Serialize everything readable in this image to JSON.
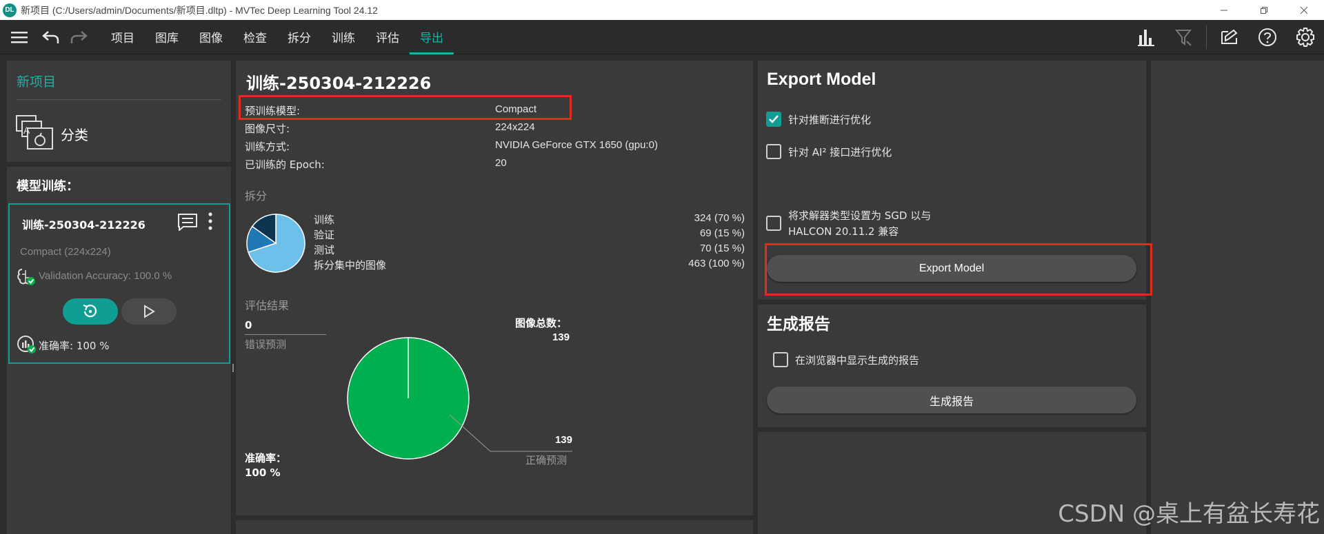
{
  "window": {
    "logo": "DL",
    "title": "新项目 (C:/Users/admin/Documents/新项目.dltp) - MVTec Deep Learning Tool 24.12"
  },
  "menu": {
    "items": [
      "项目",
      "图库",
      "图像",
      "检查",
      "拆分",
      "训练",
      "评估",
      "导出"
    ],
    "active_index": 7
  },
  "project": {
    "name": "新项目",
    "type": "分类"
  },
  "training": {
    "heading": "模型训练：",
    "card": {
      "title": "训练-250304-212226",
      "model": "Compact (224x224)",
      "validation": "Validation Accuracy: 100.0 %",
      "accuracy": "准确率: 100 %"
    }
  },
  "details": {
    "title": "训练-250304-212226",
    "rows": [
      {
        "key": "预训练模型:",
        "value": "Compact"
      },
      {
        "key": "图像尺寸:",
        "value": "224x224"
      },
      {
        "key": "训练方式:",
        "value": "NVIDIA GeForce GTX 1650 (gpu:0)"
      },
      {
        "key": "已训练的 Epoch:",
        "value": "20"
      }
    ],
    "split_label": "拆分",
    "split": [
      {
        "name": "训练",
        "value": "324  (70 %)"
      },
      {
        "name": "验证",
        "value": "69  (15 %)"
      },
      {
        "name": "测试",
        "value": "70  (15 %)"
      },
      {
        "name": "拆分集中的图像",
        "value": "463  (100 %)"
      }
    ],
    "eval_label": "评估结果",
    "errors_count": "0",
    "errors_label": "错误预测",
    "total_label": "图像总数：",
    "total_value": "139",
    "correct_count": "139",
    "correct_label": "正确预测",
    "accuracy_label": "准确率：",
    "accuracy_value": "100 %"
  },
  "export": {
    "title": "Export Model",
    "opt_inference": "针对推断进行优化",
    "opt_ai2": "针对 AI² 接口进行优化",
    "sgd_line1": "将求解器类型设置为 SGD 以与",
    "sgd_line2": "HALCON 20.11.2 兼容",
    "export_button": "Export Model",
    "report_title": "生成报告",
    "report_browser": "在浏览器中显示生成的报告",
    "report_button": "生成报告"
  },
  "watermark": "CSDN @桌上有盆长寿花",
  "colors": {
    "teal": "#19b3a6",
    "pie_train": "#6cc0ea",
    "pie_val": "#1f77b4",
    "pie_test": "#0d3552",
    "pie_correct": "#00b04f",
    "highlight": "#e02b20"
  },
  "chart_data": [
    {
      "type": "pie",
      "categories": [
        "训练",
        "验证",
        "测试"
      ],
      "values": [
        324,
        69,
        70
      ]
    },
    {
      "type": "pie",
      "categories": [
        "正确预测",
        "错误预测"
      ],
      "values": [
        139,
        0
      ]
    }
  ]
}
